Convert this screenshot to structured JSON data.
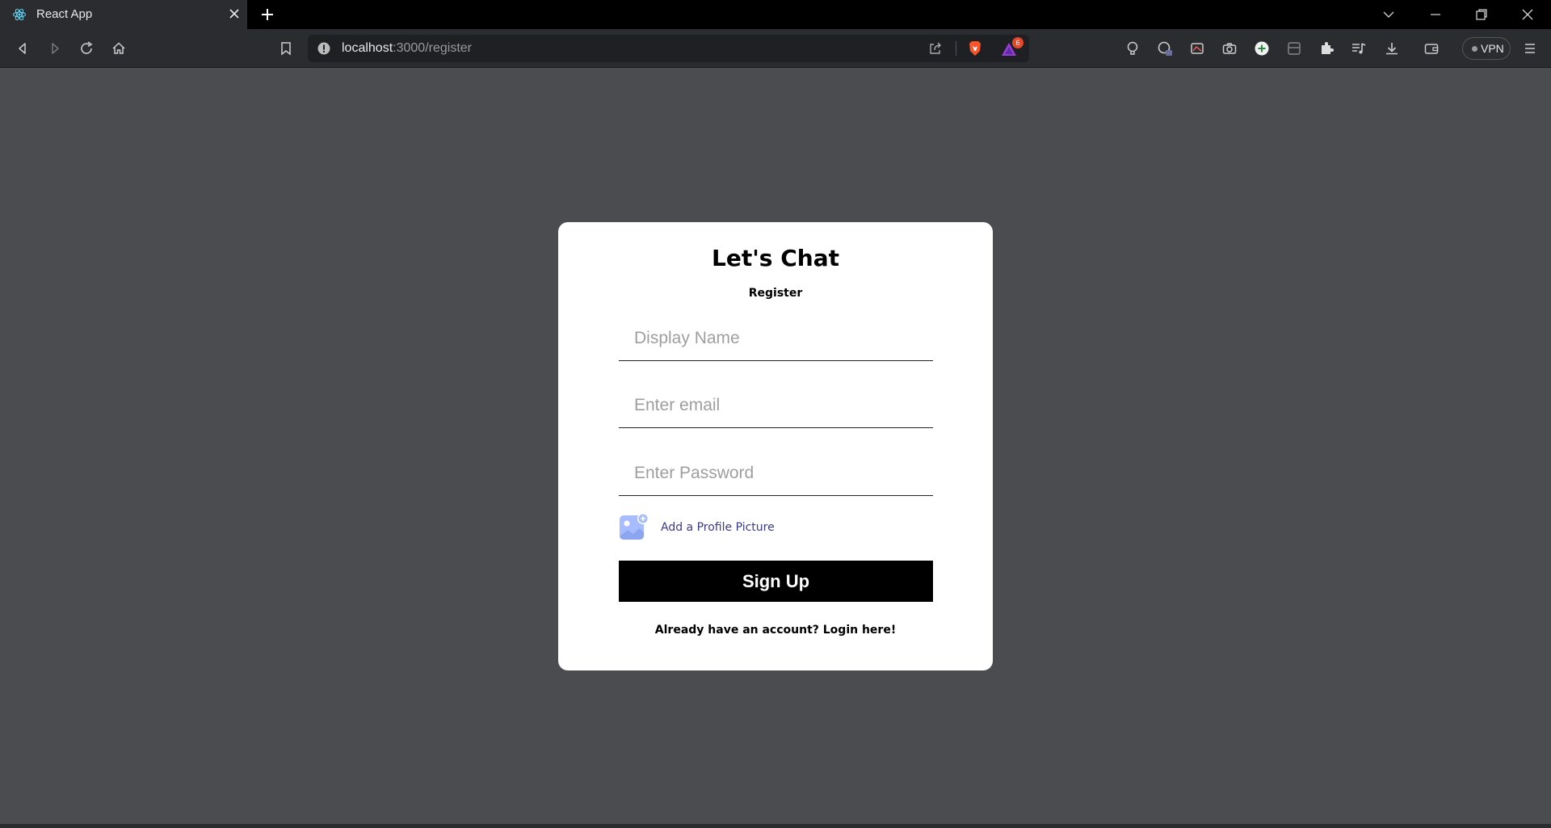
{
  "browser": {
    "tab_title": "React App",
    "url_host": "localhost",
    "url_path": ":3000/register",
    "shield_badge_count": "6",
    "vpn_label": "VPN"
  },
  "form": {
    "logo": "Let's Chat",
    "title": "Register",
    "display_name_placeholder": "Display Name",
    "email_placeholder": "Enter email",
    "password_placeholder": "Enter Password",
    "avatar_label": "Add a Profile Picture",
    "submit_label": "Sign Up",
    "login_prompt": "Already have an account? Login here!"
  },
  "colors": {
    "page_background": "#4b4c4f",
    "card_background": "#ffffff",
    "button_background": "#000000",
    "avatar_icon": "#a7bcff"
  }
}
